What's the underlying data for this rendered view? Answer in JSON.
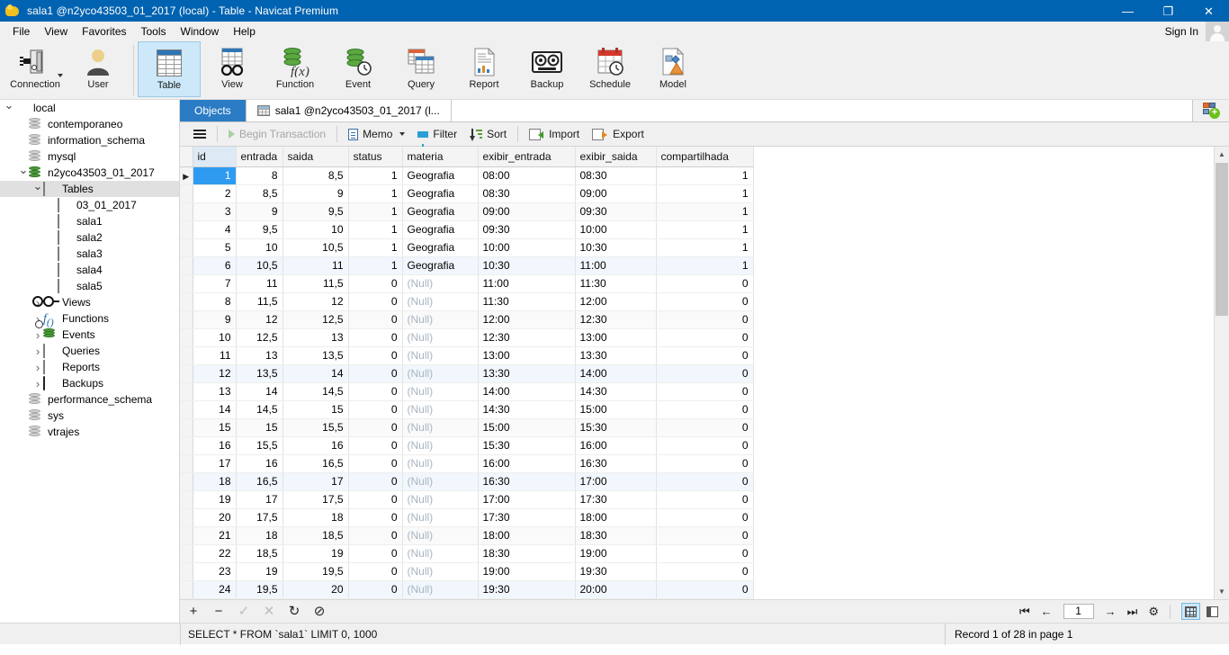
{
  "window": {
    "title": "sala1 @n2yco43503_01_2017 (local) - Table - Navicat Premium",
    "app_icon": "navicat-logo-icon",
    "minimize": "—",
    "maximize": "❐",
    "close": "✕"
  },
  "menubar": {
    "items": [
      "File",
      "View",
      "Favorites",
      "Tools",
      "Window",
      "Help"
    ],
    "signin": "Sign In"
  },
  "ribbon": {
    "left": [
      {
        "label": "Connection",
        "icon": "connection-icon",
        "caret": true
      },
      {
        "label": "User",
        "icon": "user-icon",
        "caret": false
      }
    ],
    "objects": [
      {
        "label": "Table",
        "icon": "table-icon",
        "active": true
      },
      {
        "label": "View",
        "icon": "view-glasses-icon",
        "active": false
      },
      {
        "label": "Function",
        "icon": "function-icon",
        "active": false
      },
      {
        "label": "Event",
        "icon": "event-clock-icon",
        "active": false
      },
      {
        "label": "Query",
        "icon": "query-icon",
        "active": false
      },
      {
        "label": "Report",
        "icon": "report-icon",
        "active": false
      },
      {
        "label": "Backup",
        "icon": "backup-tape-icon",
        "active": false
      },
      {
        "label": "Schedule",
        "icon": "schedule-calendar-icon",
        "active": false
      },
      {
        "label": "Model",
        "icon": "model-icon",
        "active": false
      }
    ]
  },
  "sidebar": {
    "items": [
      {
        "label": "local",
        "depth": 0,
        "chev": "open",
        "icon": "connection-green-icon"
      },
      {
        "label": "contemporaneo",
        "depth": 1,
        "chev": "none",
        "icon": "database-grey-icon"
      },
      {
        "label": "information_schema",
        "depth": 1,
        "chev": "none",
        "icon": "database-grey-icon"
      },
      {
        "label": "mysql",
        "depth": 1,
        "chev": "none",
        "icon": "database-grey-icon"
      },
      {
        "label": "n2yco43503_01_2017",
        "depth": 1,
        "chev": "open",
        "icon": "database-green-icon"
      },
      {
        "label": "Tables",
        "depth": 2,
        "chev": "open",
        "icon": "tables-folder-icon",
        "selected": true
      },
      {
        "label": "03_01_2017",
        "depth": 3,
        "chev": "none",
        "icon": "table-icon"
      },
      {
        "label": "sala1",
        "depth": 3,
        "chev": "none",
        "icon": "table-icon"
      },
      {
        "label": "sala2",
        "depth": 3,
        "chev": "none",
        "icon": "table-icon"
      },
      {
        "label": "sala3",
        "depth": 3,
        "chev": "none",
        "icon": "table-icon"
      },
      {
        "label": "sala4",
        "depth": 3,
        "chev": "none",
        "icon": "table-icon"
      },
      {
        "label": "sala5",
        "depth": 3,
        "chev": "none",
        "icon": "table-icon"
      },
      {
        "label": "Views",
        "depth": 2,
        "chev": "closed",
        "icon": "views-glasses-icon"
      },
      {
        "label": "Functions",
        "depth": 2,
        "chev": "closed",
        "icon": "functions-icon"
      },
      {
        "label": "Events",
        "depth": 2,
        "chev": "closed",
        "icon": "events-icon"
      },
      {
        "label": "Queries",
        "depth": 2,
        "chev": "closed",
        "icon": "queries-icon"
      },
      {
        "label": "Reports",
        "depth": 2,
        "chev": "closed",
        "icon": "reports-icon"
      },
      {
        "label": "Backups",
        "depth": 2,
        "chev": "closed",
        "icon": "backups-icon"
      },
      {
        "label": "performance_schema",
        "depth": 1,
        "chev": "none",
        "icon": "database-grey-icon"
      },
      {
        "label": "sys",
        "depth": 1,
        "chev": "none",
        "icon": "database-grey-icon"
      },
      {
        "label": "vtrajes",
        "depth": 1,
        "chev": "none",
        "icon": "database-grey-icon"
      }
    ]
  },
  "tabs": {
    "objects_label": "Objects",
    "doc_label": "sala1 @n2yco43503_01_2017 (l...",
    "doc_icon": "table-icon",
    "add_icon": "new-object-icon"
  },
  "grid_toolbar": {
    "menu_icon": "hamburger-icon",
    "begin_transaction": "Begin Transaction",
    "memo": "Memo",
    "filter": "Filter",
    "sort": "Sort",
    "import": "Import",
    "export": "Export"
  },
  "grid": {
    "columns": [
      "id",
      "entrada",
      "saida",
      "status",
      "materia",
      "exibir_entrada",
      "exibir_saida",
      "compartilhada"
    ],
    "selected_column": "id",
    "selected_row": 1,
    "null_text": "(Null)",
    "rows": [
      {
        "id": "1",
        "entrada": "8",
        "saida": "8,5",
        "status": "1",
        "materia": "Geografia",
        "exibir_entrada": "08:00",
        "exibir_saida": "08:30",
        "compartilhada": "1"
      },
      {
        "id": "2",
        "entrada": "8,5",
        "saida": "9",
        "status": "1",
        "materia": "Geografia",
        "exibir_entrada": "08:30",
        "exibir_saida": "09:00",
        "compartilhada": "1"
      },
      {
        "id": "3",
        "entrada": "9",
        "saida": "9,5",
        "status": "1",
        "materia": "Geografia",
        "exibir_entrada": "09:00",
        "exibir_saida": "09:30",
        "compartilhada": "1"
      },
      {
        "id": "4",
        "entrada": "9,5",
        "saida": "10",
        "status": "1",
        "materia": "Geografia",
        "exibir_entrada": "09:30",
        "exibir_saida": "10:00",
        "compartilhada": "1"
      },
      {
        "id": "5",
        "entrada": "10",
        "saida": "10,5",
        "status": "1",
        "materia": "Geografia",
        "exibir_entrada": "10:00",
        "exibir_saida": "10:30",
        "compartilhada": "1"
      },
      {
        "id": "6",
        "entrada": "10,5",
        "saida": "11",
        "status": "1",
        "materia": "Geografia",
        "exibir_entrada": "10:30",
        "exibir_saida": "11:00",
        "compartilhada": "1"
      },
      {
        "id": "7",
        "entrada": "11",
        "saida": "11,5",
        "status": "0",
        "materia": null,
        "exibir_entrada": "11:00",
        "exibir_saida": "11:30",
        "compartilhada": "0"
      },
      {
        "id": "8",
        "entrada": "11,5",
        "saida": "12",
        "status": "0",
        "materia": null,
        "exibir_entrada": "11:30",
        "exibir_saida": "12:00",
        "compartilhada": "0"
      },
      {
        "id": "9",
        "entrada": "12",
        "saida": "12,5",
        "status": "0",
        "materia": null,
        "exibir_entrada": "12:00",
        "exibir_saida": "12:30",
        "compartilhada": "0"
      },
      {
        "id": "10",
        "entrada": "12,5",
        "saida": "13",
        "status": "0",
        "materia": null,
        "exibir_entrada": "12:30",
        "exibir_saida": "13:00",
        "compartilhada": "0"
      },
      {
        "id": "11",
        "entrada": "13",
        "saida": "13,5",
        "status": "0",
        "materia": null,
        "exibir_entrada": "13:00",
        "exibir_saida": "13:30",
        "compartilhada": "0"
      },
      {
        "id": "12",
        "entrada": "13,5",
        "saida": "14",
        "status": "0",
        "materia": null,
        "exibir_entrada": "13:30",
        "exibir_saida": "14:00",
        "compartilhada": "0"
      },
      {
        "id": "13",
        "entrada": "14",
        "saida": "14,5",
        "status": "0",
        "materia": null,
        "exibir_entrada": "14:00",
        "exibir_saida": "14:30",
        "compartilhada": "0"
      },
      {
        "id": "14",
        "entrada": "14,5",
        "saida": "15",
        "status": "0",
        "materia": null,
        "exibir_entrada": "14:30",
        "exibir_saida": "15:00",
        "compartilhada": "0"
      },
      {
        "id": "15",
        "entrada": "15",
        "saida": "15,5",
        "status": "0",
        "materia": null,
        "exibir_entrada": "15:00",
        "exibir_saida": "15:30",
        "compartilhada": "0"
      },
      {
        "id": "16",
        "entrada": "15,5",
        "saida": "16",
        "status": "0",
        "materia": null,
        "exibir_entrada": "15:30",
        "exibir_saida": "16:00",
        "compartilhada": "0"
      },
      {
        "id": "17",
        "entrada": "16",
        "saida": "16,5",
        "status": "0",
        "materia": null,
        "exibir_entrada": "16:00",
        "exibir_saida": "16:30",
        "compartilhada": "0"
      },
      {
        "id": "18",
        "entrada": "16,5",
        "saida": "17",
        "status": "0",
        "materia": null,
        "exibir_entrada": "16:30",
        "exibir_saida": "17:00",
        "compartilhada": "0"
      },
      {
        "id": "19",
        "entrada": "17",
        "saida": "17,5",
        "status": "0",
        "materia": null,
        "exibir_entrada": "17:00",
        "exibir_saida": "17:30",
        "compartilhada": "0"
      },
      {
        "id": "20",
        "entrada": "17,5",
        "saida": "18",
        "status": "0",
        "materia": null,
        "exibir_entrada": "17:30",
        "exibir_saida": "18:00",
        "compartilhada": "0"
      },
      {
        "id": "21",
        "entrada": "18",
        "saida": "18,5",
        "status": "0",
        "materia": null,
        "exibir_entrada": "18:00",
        "exibir_saida": "18:30",
        "compartilhada": "0"
      },
      {
        "id": "22",
        "entrada": "18,5",
        "saida": "19",
        "status": "0",
        "materia": null,
        "exibir_entrada": "18:30",
        "exibir_saida": "19:00",
        "compartilhada": "0"
      },
      {
        "id": "23",
        "entrada": "19",
        "saida": "19,5",
        "status": "0",
        "materia": null,
        "exibir_entrada": "19:00",
        "exibir_saida": "19:30",
        "compartilhada": "0"
      },
      {
        "id": "24",
        "entrada": "19,5",
        "saida": "20",
        "status": "0",
        "materia": null,
        "exibir_entrada": "19:30",
        "exibir_saida": "20:00",
        "compartilhada": "0"
      }
    ]
  },
  "edit_toolbar": {
    "add": "+",
    "remove": "−",
    "confirm": "✓",
    "cancel": "✕",
    "refresh": "↻",
    "stop": "⊘"
  },
  "pager": {
    "first": "⏮",
    "prev": "←",
    "page_value": "1",
    "next": "→",
    "last": "⏭",
    "settings": "⚙",
    "grid_view_icon": "grid-view-icon",
    "form_view_icon": "form-view-icon"
  },
  "statusbar": {
    "sql": "SELECT * FROM `sala1` LIMIT 0, 1000",
    "record_info": "Record 1 of 28 in page 1"
  },
  "colors": {
    "titlebar": "#0063b1",
    "accent_tab": "#2b7cc4",
    "selection": "#2f9bf0",
    "chrome": "#f0f0f0"
  }
}
